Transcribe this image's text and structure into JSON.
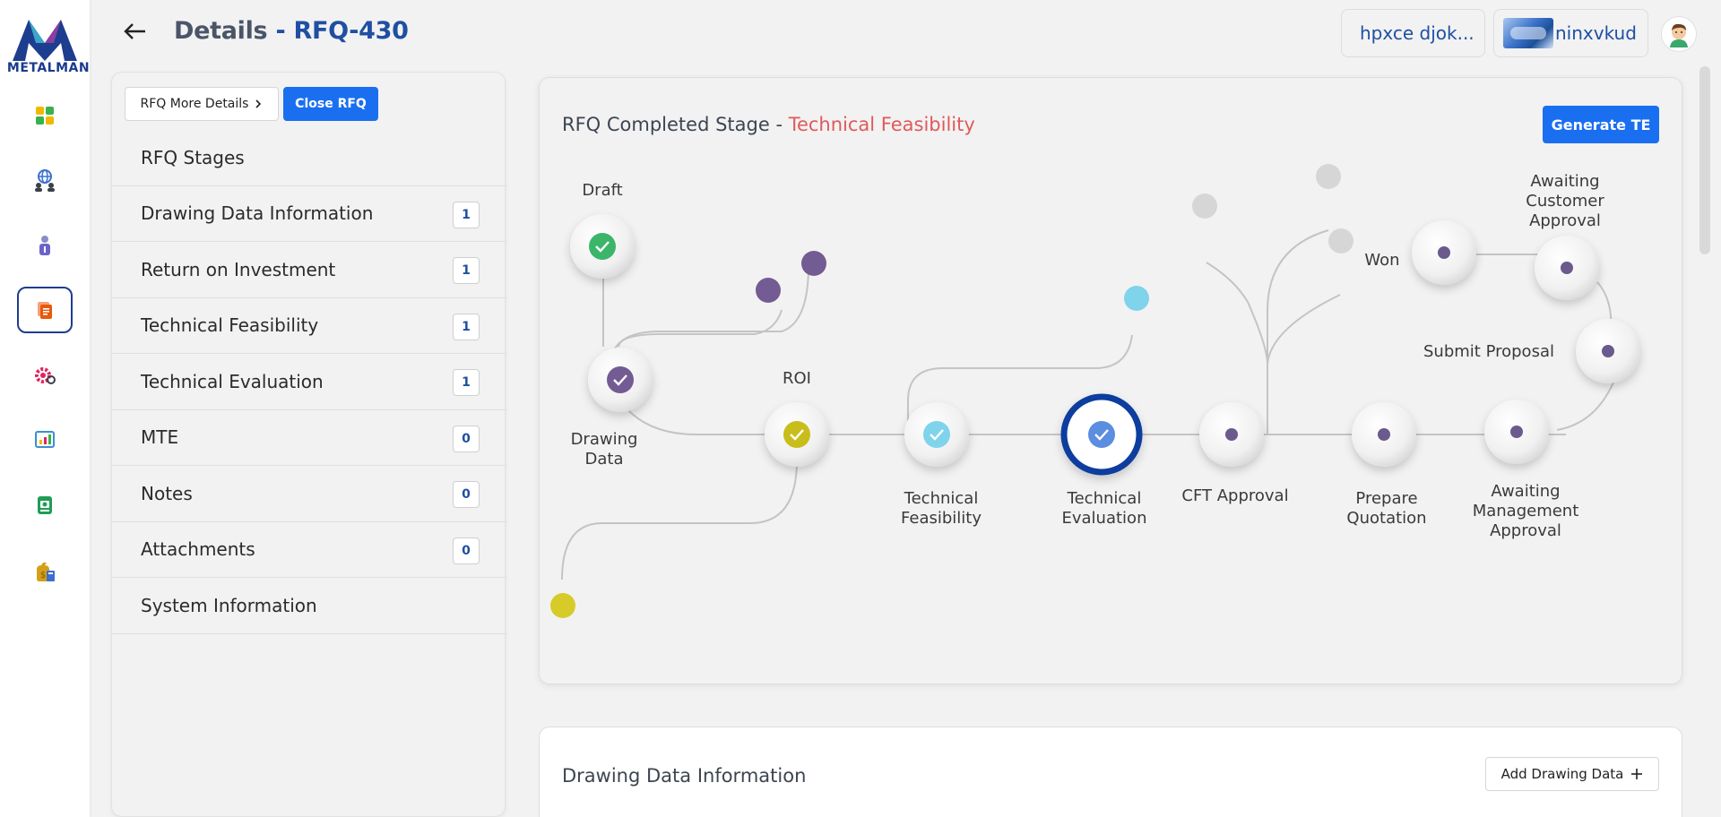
{
  "brand": {
    "logo_text": "METALMAN"
  },
  "header": {
    "title": "Details",
    "separator": " - ",
    "rfq_id": "RFQ-430",
    "pill_1": "hpxce djok...",
    "pill_2": "ninxvkud"
  },
  "rail": {
    "items": [
      {
        "icon": "dashboard-icon"
      },
      {
        "icon": "customer-globe-icon"
      },
      {
        "icon": "user-info-icon"
      },
      {
        "icon": "documents-icon",
        "active": true
      },
      {
        "icon": "settings-gear-icon"
      },
      {
        "icon": "analytics-chart-icon"
      },
      {
        "icon": "inventory-icon"
      },
      {
        "icon": "finance-money-icon"
      }
    ]
  },
  "sidepanel": {
    "more_details_label": "RFQ More Details",
    "close_rfq_label": "Close RFQ",
    "stages_heading": "RFQ Stages",
    "items": [
      {
        "label": "Drawing Data Information",
        "count": "1"
      },
      {
        "label": "Return on Investment",
        "count": "1"
      },
      {
        "label": "Technical Feasibility",
        "count": "1"
      },
      {
        "label": "Technical Evaluation",
        "count": "1"
      },
      {
        "label": "MTE",
        "count": "0"
      },
      {
        "label": "Notes",
        "count": "0"
      },
      {
        "label": "Attachments",
        "count": "0"
      },
      {
        "label": "System Information",
        "count": ""
      }
    ]
  },
  "stage_card": {
    "title_prefix": "RFQ Completed Stage - ",
    "title_stage": "Technical Feasibility",
    "generate_button": "Generate TE",
    "nodes": {
      "draft": "Draft",
      "drawing_data_1": "Drawing",
      "drawing_data_2": "Data",
      "roi": "ROI",
      "tech_feas_1": "Technical",
      "tech_feas_2": "Feasibility",
      "tech_eval_1": "Technical",
      "tech_eval_2": "Evaluation",
      "cft": "CFT Approval",
      "prep_1": "Prepare",
      "prep_2": "Quotation",
      "mgmt_1": "Awaiting",
      "mgmt_2": "Management",
      "mgmt_3": "Approval",
      "submit": "Submit Proposal",
      "won": "Won",
      "cust_1": "Awaiting",
      "cust_2": "Customer",
      "cust_3": "Approval"
    },
    "colors": {
      "complete_green": "#3bb56a",
      "drawing_purple": "#735b93",
      "roi_yellow": "#c9bd1c",
      "feas_cyan": "#7fd3ea",
      "eval_blue": "#5b8de0",
      "eval_ring": "#0d3c9e",
      "pending_dot": "#6a5a8e"
    }
  },
  "drawing_card": {
    "title": "Drawing Data Information",
    "add_button": "Add Drawing Data"
  }
}
